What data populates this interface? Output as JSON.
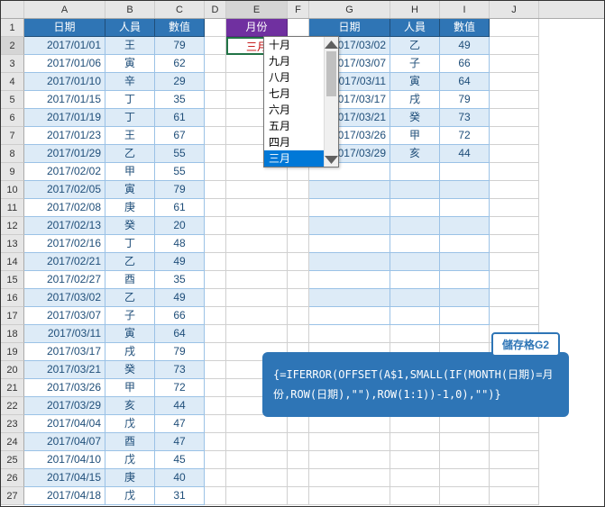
{
  "columns": [
    "A",
    "B",
    "C",
    "D",
    "E",
    "F",
    "G",
    "H",
    "I",
    "J"
  ],
  "rowCount": 27,
  "headers1": {
    "A": "日期",
    "B": "人員",
    "C": "數值"
  },
  "headers2": {
    "E": "月份"
  },
  "headers3": {
    "G": "日期",
    "H": "人員",
    "I": "數值"
  },
  "table1": [
    {
      "date": "2017/01/01",
      "person": "王",
      "value": 79
    },
    {
      "date": "2017/01/06",
      "person": "寅",
      "value": 62
    },
    {
      "date": "2017/01/10",
      "person": "辛",
      "value": 29
    },
    {
      "date": "2017/01/15",
      "person": "丁",
      "value": 35
    },
    {
      "date": "2017/01/19",
      "person": "丁",
      "value": 61
    },
    {
      "date": "2017/01/23",
      "person": "王",
      "value": 67
    },
    {
      "date": "2017/01/29",
      "person": "乙",
      "value": 55
    },
    {
      "date": "2017/02/02",
      "person": "甲",
      "value": 55
    },
    {
      "date": "2017/02/05",
      "person": "寅",
      "value": 79
    },
    {
      "date": "2017/02/08",
      "person": "庚",
      "value": 61
    },
    {
      "date": "2017/02/13",
      "person": "癸",
      "value": 20
    },
    {
      "date": "2017/02/16",
      "person": "丁",
      "value": 48
    },
    {
      "date": "2017/02/21",
      "person": "乙",
      "value": 49
    },
    {
      "date": "2017/02/27",
      "person": "酉",
      "value": 35
    },
    {
      "date": "2017/03/02",
      "person": "乙",
      "value": 49
    },
    {
      "date": "2017/03/07",
      "person": "子",
      "value": 66
    },
    {
      "date": "2017/03/11",
      "person": "寅",
      "value": 64
    },
    {
      "date": "2017/03/17",
      "person": "戌",
      "value": 79
    },
    {
      "date": "2017/03/21",
      "person": "癸",
      "value": 73
    },
    {
      "date": "2017/03/26",
      "person": "甲",
      "value": 72
    },
    {
      "date": "2017/03/29",
      "person": "亥",
      "value": 44
    },
    {
      "date": "2017/04/04",
      "person": "戊",
      "value": 47
    },
    {
      "date": "2017/04/07",
      "person": "酉",
      "value": 47
    },
    {
      "date": "2017/04/10",
      "person": "戊",
      "value": 45
    },
    {
      "date": "2017/04/15",
      "person": "庚",
      "value": 40
    },
    {
      "date": "2017/04/18",
      "person": "戊",
      "value": 31
    }
  ],
  "dropdown": {
    "selected": "三月",
    "options": [
      "三月",
      "四月",
      "五月",
      "六月",
      "七月",
      "八月",
      "九月",
      "十月"
    ]
  },
  "table2": [
    {
      "date": "2017/03/02",
      "person": "乙",
      "value": 49
    },
    {
      "date": "2017/03/07",
      "person": "子",
      "value": 66
    },
    {
      "date": "2017/03/11",
      "person": "寅",
      "value": 64
    },
    {
      "date": "2017/03/17",
      "person": "戌",
      "value": 79
    },
    {
      "date": "2017/03/21",
      "person": "癸",
      "value": 73
    },
    {
      "date": "2017/03/26",
      "person": "甲",
      "value": 72
    },
    {
      "date": "2017/03/29",
      "person": "亥",
      "value": 44
    }
  ],
  "callout": {
    "tag": "儲存格G2",
    "formula": "{=IFERROR(OFFSET(A$1,SMALL(IF(MONTH(日期)=月份,ROW(日期),\"\"),ROW(1:1))-1,0),\"\")}"
  }
}
